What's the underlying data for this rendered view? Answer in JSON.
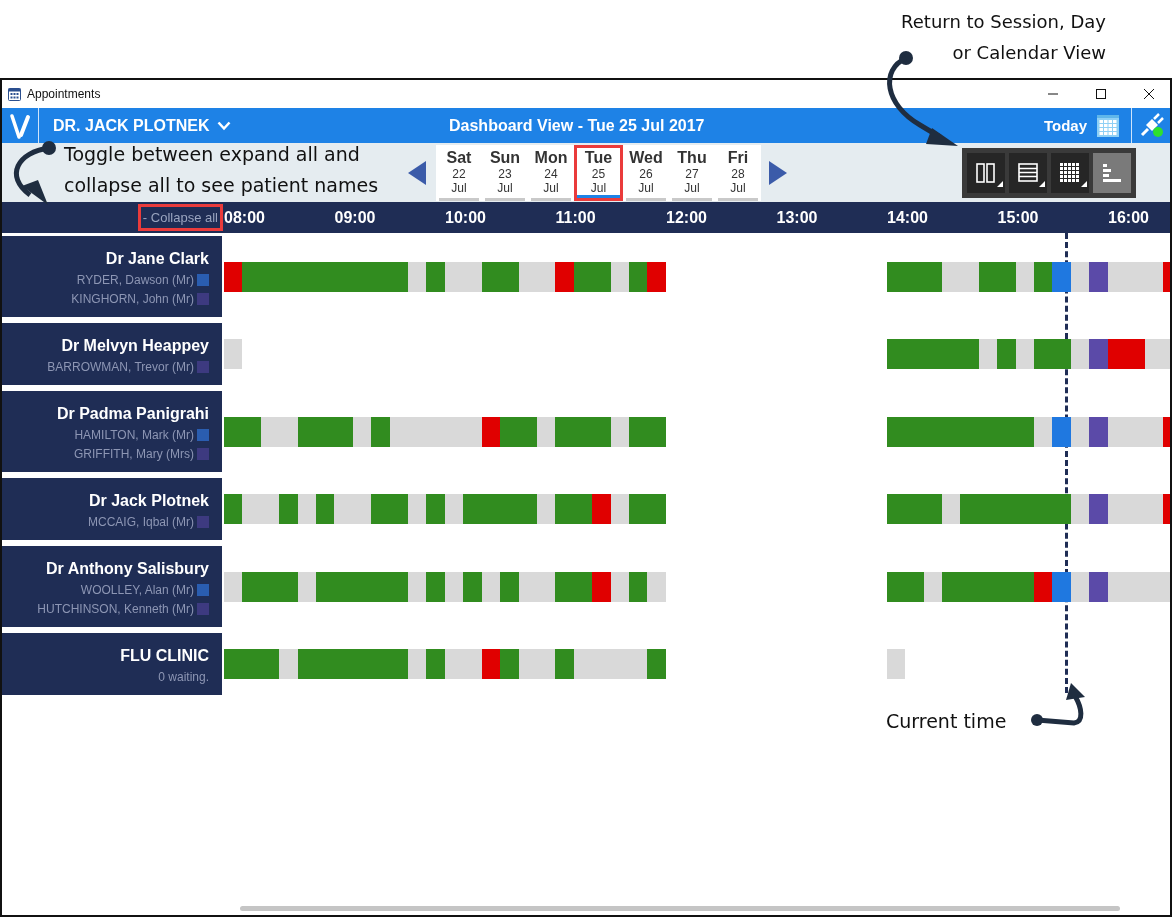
{
  "window": {
    "title": "Appointments"
  },
  "header": {
    "clinician": "DR. JACK PLOTNEK",
    "title": "Dashboard View - Tue 25 Jul 2017",
    "today": "Today"
  },
  "days": [
    {
      "weekday": "Sat",
      "day": "22",
      "month": "Jul",
      "selected": false,
      "highlighted": false
    },
    {
      "weekday": "Sun",
      "day": "23",
      "month": "Jul",
      "selected": false,
      "highlighted": false
    },
    {
      "weekday": "Mon",
      "day": "24",
      "month": "Jul",
      "selected": false,
      "highlighted": false
    },
    {
      "weekday": "Tue",
      "day": "25",
      "month": "Jul",
      "selected": true,
      "highlighted": true
    },
    {
      "weekday": "Wed",
      "day": "26",
      "month": "Jul",
      "selected": false,
      "highlighted": false
    },
    {
      "weekday": "Thu",
      "day": "27",
      "month": "Jul",
      "selected": false,
      "highlighted": false
    },
    {
      "weekday": "Fri",
      "day": "28",
      "month": "Jul",
      "selected": false,
      "highlighted": false
    }
  ],
  "views": [
    {
      "kind": "columns",
      "selected": false
    },
    {
      "kind": "rows",
      "selected": false
    },
    {
      "kind": "grid",
      "selected": false
    },
    {
      "kind": "bars",
      "selected": true
    }
  ],
  "timeline": {
    "toggle": {
      "label": "- Collapse all",
      "highlighted": true
    },
    "hours": [
      "08:00",
      "09:00",
      "10:00",
      "11:00",
      "12:00",
      "13:00",
      "14:00",
      "15:00",
      "16:00"
    ],
    "current_time": {
      "level": 0.891
    }
  },
  "rows": [
    {
      "name": "Dr Jane Clark",
      "patients": [
        {
          "name": "RYDER, Dawson (Mr)",
          "color": "#2a5db0"
        },
        {
          "name": "KINGHORN, John (Mr)",
          "color": "#3d3a80"
        }
      ],
      "sessions": [
        {
          "kind": "am",
          "slots": [
            {
              "color": "#e00000"
            },
            {
              "color": "#318c1f"
            },
            {
              "color": "#318c1f"
            },
            {
              "color": "#318c1f"
            },
            {
              "color": "#318c1f"
            },
            {
              "color": "#318c1f"
            },
            {
              "color": "#318c1f"
            },
            {
              "color": "#318c1f"
            },
            {
              "color": "#318c1f"
            },
            {
              "color": "#318c1f"
            },
            {
              "color": "#d9d9d9"
            },
            {
              "color": "#318c1f"
            },
            {
              "color": "#d9d9d9"
            },
            {
              "color": "#d9d9d9"
            },
            {
              "color": "#318c1f"
            },
            {
              "color": "#318c1f"
            },
            {
              "color": "#d9d9d9"
            },
            {
              "color": "#d9d9d9"
            },
            {
              "color": "#e00000"
            },
            {
              "color": "#318c1f"
            },
            {
              "color": "#318c1f"
            },
            {
              "color": "#d9d9d9"
            },
            {
              "color": "#318c1f"
            },
            {
              "color": "#e00000"
            }
          ]
        },
        {
          "kind": "pm",
          "slots": [
            {
              "color": "#318c1f"
            },
            {
              "color": "#318c1f"
            },
            {
              "color": "#318c1f"
            },
            {
              "color": "#d9d9d9"
            },
            {
              "color": "#d9d9d9"
            },
            {
              "color": "#318c1f"
            },
            {
              "color": "#318c1f"
            },
            {
              "color": "#d9d9d9"
            },
            {
              "color": "#318c1f"
            },
            {
              "color": "#1f78e0"
            },
            {
              "color": "#d9d9d9"
            },
            {
              "color": "#5b4aa8"
            },
            {
              "color": "#d9d9d9"
            },
            {
              "color": "#d9d9d9"
            },
            {
              "color": "#d9d9d9"
            },
            {
              "color": "#e00000"
            }
          ]
        }
      ]
    },
    {
      "name": "Dr Melvyn Heappey",
      "patients": [
        {
          "name": "BARROWMAN, Trevor (Mr)",
          "color": "#3d3a80"
        }
      ],
      "sessions": [
        {
          "kind": "am",
          "slots": [
            {
              "color": "#d9d9d9"
            }
          ]
        },
        {
          "kind": "pm",
          "slots": [
            {
              "color": "#318c1f"
            },
            {
              "color": "#318c1f"
            },
            {
              "color": "#318c1f"
            },
            {
              "color": "#318c1f"
            },
            {
              "color": "#318c1f"
            },
            {
              "color": "#d9d9d9"
            },
            {
              "color": "#318c1f"
            },
            {
              "color": "#d9d9d9"
            },
            {
              "color": "#318c1f"
            },
            {
              "color": "#318c1f"
            },
            {
              "color": "#d9d9d9"
            },
            {
              "color": "#5b4aa8"
            },
            {
              "color": "#e00000"
            },
            {
              "color": "#e00000"
            },
            {
              "color": "#d9d9d9"
            },
            {
              "color": "#d9d9d9"
            }
          ]
        }
      ]
    },
    {
      "name": "Dr Padma Panigrahi",
      "patients": [
        {
          "name": "HAMILTON, Mark (Mr)",
          "color": "#2a5db0"
        },
        {
          "name": "GRIFFITH, Mary (Mrs)",
          "color": "#3d3a80"
        }
      ],
      "sessions": [
        {
          "kind": "am",
          "slots": [
            {
              "color": "#318c1f"
            },
            {
              "color": "#318c1f"
            },
            {
              "color": "#d9d9d9"
            },
            {
              "color": "#d9d9d9"
            },
            {
              "color": "#318c1f"
            },
            {
              "color": "#318c1f"
            },
            {
              "color": "#318c1f"
            },
            {
              "color": "#d9d9d9"
            },
            {
              "color": "#318c1f"
            },
            {
              "color": "#d9d9d9"
            },
            {
              "color": "#d9d9d9"
            },
            {
              "color": "#d9d9d9"
            },
            {
              "color": "#d9d9d9"
            },
            {
              "color": "#d9d9d9"
            },
            {
              "color": "#e00000"
            },
            {
              "color": "#318c1f"
            },
            {
              "color": "#318c1f"
            },
            {
              "color": "#d9d9d9"
            },
            {
              "color": "#318c1f"
            },
            {
              "color": "#318c1f"
            },
            {
              "color": "#318c1f"
            },
            {
              "color": "#d9d9d9"
            },
            {
              "color": "#318c1f"
            },
            {
              "color": "#318c1f"
            }
          ]
        },
        {
          "kind": "pm",
          "slots": [
            {
              "color": "#318c1f"
            },
            {
              "color": "#318c1f"
            },
            {
              "color": "#318c1f"
            },
            {
              "color": "#318c1f"
            },
            {
              "color": "#318c1f"
            },
            {
              "color": "#318c1f"
            },
            {
              "color": "#318c1f"
            },
            {
              "color": "#318c1f"
            },
            {
              "color": "#d9d9d9"
            },
            {
              "color": "#1f78e0"
            },
            {
              "color": "#d9d9d9"
            },
            {
              "color": "#5b4aa8"
            },
            {
              "color": "#d9d9d9"
            },
            {
              "color": "#d9d9d9"
            },
            {
              "color": "#d9d9d9"
            },
            {
              "color": "#e00000"
            }
          ]
        }
      ]
    },
    {
      "name": "Dr Jack Plotnek",
      "patients": [
        {
          "name": "MCCAIG, Iqbal (Mr)",
          "color": "#3d3a80"
        }
      ],
      "sessions": [
        {
          "kind": "am",
          "slots": [
            {
              "color": "#318c1f"
            },
            {
              "color": "#d9d9d9"
            },
            {
              "color": "#d9d9d9"
            },
            {
              "color": "#318c1f"
            },
            {
              "color": "#d9d9d9"
            },
            {
              "color": "#318c1f"
            },
            {
              "color": "#d9d9d9"
            },
            {
              "color": "#d9d9d9"
            },
            {
              "color": "#318c1f"
            },
            {
              "color": "#318c1f"
            },
            {
              "color": "#d9d9d9"
            },
            {
              "color": "#318c1f"
            },
            {
              "color": "#d9d9d9"
            },
            {
              "color": "#318c1f"
            },
            {
              "color": "#318c1f"
            },
            {
              "color": "#318c1f"
            },
            {
              "color": "#318c1f"
            },
            {
              "color": "#d9d9d9"
            },
            {
              "color": "#318c1f"
            },
            {
              "color": "#318c1f"
            },
            {
              "color": "#e00000"
            },
            {
              "color": "#d9d9d9"
            },
            {
              "color": "#318c1f"
            },
            {
              "color": "#318c1f"
            }
          ]
        },
        {
          "kind": "pm",
          "slots": [
            {
              "color": "#318c1f"
            },
            {
              "color": "#318c1f"
            },
            {
              "color": "#318c1f"
            },
            {
              "color": "#d9d9d9"
            },
            {
              "color": "#318c1f"
            },
            {
              "color": "#318c1f"
            },
            {
              "color": "#318c1f"
            },
            {
              "color": "#318c1f"
            },
            {
              "color": "#318c1f"
            },
            {
              "color": "#318c1f"
            },
            {
              "color": "#d9d9d9"
            },
            {
              "color": "#5b4aa8"
            },
            {
              "color": "#d9d9d9"
            },
            {
              "color": "#d9d9d9"
            },
            {
              "color": "#d9d9d9"
            },
            {
              "color": "#e00000"
            }
          ]
        }
      ]
    },
    {
      "name": "Dr Anthony Salisbury",
      "patients": [
        {
          "name": "WOOLLEY, Alan (Mr)",
          "color": "#2a5db0"
        },
        {
          "name": "HUTCHINSON, Kenneth (Mr)",
          "color": "#3d3a80"
        }
      ],
      "sessions": [
        {
          "kind": "am",
          "slots": [
            {
              "color": "#d9d9d9"
            },
            {
              "color": "#318c1f"
            },
            {
              "color": "#318c1f"
            },
            {
              "color": "#318c1f"
            },
            {
              "color": "#d9d9d9"
            },
            {
              "color": "#318c1f"
            },
            {
              "color": "#318c1f"
            },
            {
              "color": "#318c1f"
            },
            {
              "color": "#318c1f"
            },
            {
              "color": "#318c1f"
            },
            {
              "color": "#d9d9d9"
            },
            {
              "color": "#318c1f"
            },
            {
              "color": "#d9d9d9"
            },
            {
              "color": "#318c1f"
            },
            {
              "color": "#d9d9d9"
            },
            {
              "color": "#318c1f"
            },
            {
              "color": "#d9d9d9"
            },
            {
              "color": "#d9d9d9"
            },
            {
              "color": "#318c1f"
            },
            {
              "color": "#318c1f"
            },
            {
              "color": "#e00000"
            },
            {
              "color": "#d9d9d9"
            },
            {
              "color": "#318c1f"
            },
            {
              "color": "#d9d9d9"
            }
          ]
        },
        {
          "kind": "pm",
          "slots": [
            {
              "color": "#318c1f"
            },
            {
              "color": "#318c1f"
            },
            {
              "color": "#d9d9d9"
            },
            {
              "color": "#318c1f"
            },
            {
              "color": "#318c1f"
            },
            {
              "color": "#318c1f"
            },
            {
              "color": "#318c1f"
            },
            {
              "color": "#318c1f"
            },
            {
              "color": "#e00000"
            },
            {
              "color": "#1f78e0"
            },
            {
              "color": "#d9d9d9"
            },
            {
              "color": "#5b4aa8"
            },
            {
              "color": "#d9d9d9"
            },
            {
              "color": "#d9d9d9"
            },
            {
              "color": "#d9d9d9"
            },
            {
              "color": "#d9d9d9"
            }
          ]
        }
      ]
    },
    {
      "name": "FLU CLINIC",
      "note": "0 waiting.",
      "sessions": [
        {
          "kind": "am",
          "slots": [
            {
              "color": "#318c1f"
            },
            {
              "color": "#318c1f"
            },
            {
              "color": "#318c1f"
            },
            {
              "color": "#d9d9d9"
            },
            {
              "color": "#318c1f"
            },
            {
              "color": "#318c1f"
            },
            {
              "color": "#318c1f"
            },
            {
              "color": "#318c1f"
            },
            {
              "color": "#318c1f"
            },
            {
              "color": "#318c1f"
            },
            {
              "color": "#d9d9d9"
            },
            {
              "color": "#318c1f"
            },
            {
              "color": "#d9d9d9"
            },
            {
              "color": "#d9d9d9"
            },
            {
              "color": "#e00000"
            },
            {
              "color": "#318c1f"
            },
            {
              "color": "#d9d9d9"
            },
            {
              "color": "#d9d9d9"
            },
            {
              "color": "#318c1f"
            },
            {
              "color": "#d9d9d9"
            },
            {
              "color": "#d9d9d9"
            },
            {
              "color": "#d9d9d9"
            },
            {
              "color": "#d9d9d9"
            },
            {
              "color": "#318c1f"
            }
          ]
        },
        {
          "kind": "pm",
          "slots": [
            {
              "color": "#d9d9d9"
            }
          ]
        }
      ]
    }
  ],
  "annotations": [
    {
      "kind": "expand",
      "lines": [
        "Toggle between expand all and",
        "collapse all to see patient names"
      ]
    },
    {
      "kind": "views",
      "lines": [
        "Return to Session, Day",
        "or Calendar View"
      ]
    },
    {
      "kind": "time",
      "lines": [
        "Current time"
      ]
    }
  ]
}
